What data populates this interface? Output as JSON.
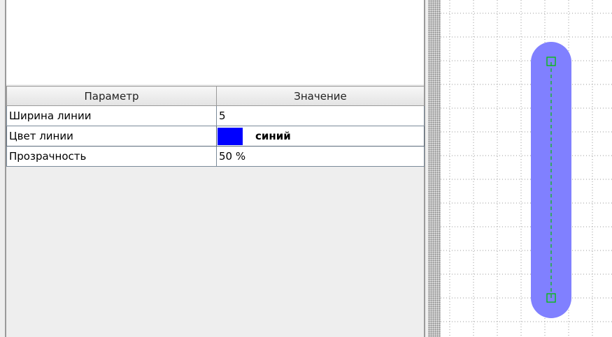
{
  "properties_table": {
    "headers": {
      "param": "Параметр",
      "value": "Значение"
    },
    "rows": [
      {
        "param": "Ширина линии",
        "value": "5"
      },
      {
        "param": "Цвет линии",
        "value": "синий",
        "swatch_color": "#0000ff"
      },
      {
        "param": "Прозрачность",
        "value": "50 %"
      }
    ]
  },
  "canvas": {
    "line_color": "#8080ff",
    "endpoint_marker_color": "#00c000",
    "grid_color": "#9a9a9a"
  }
}
